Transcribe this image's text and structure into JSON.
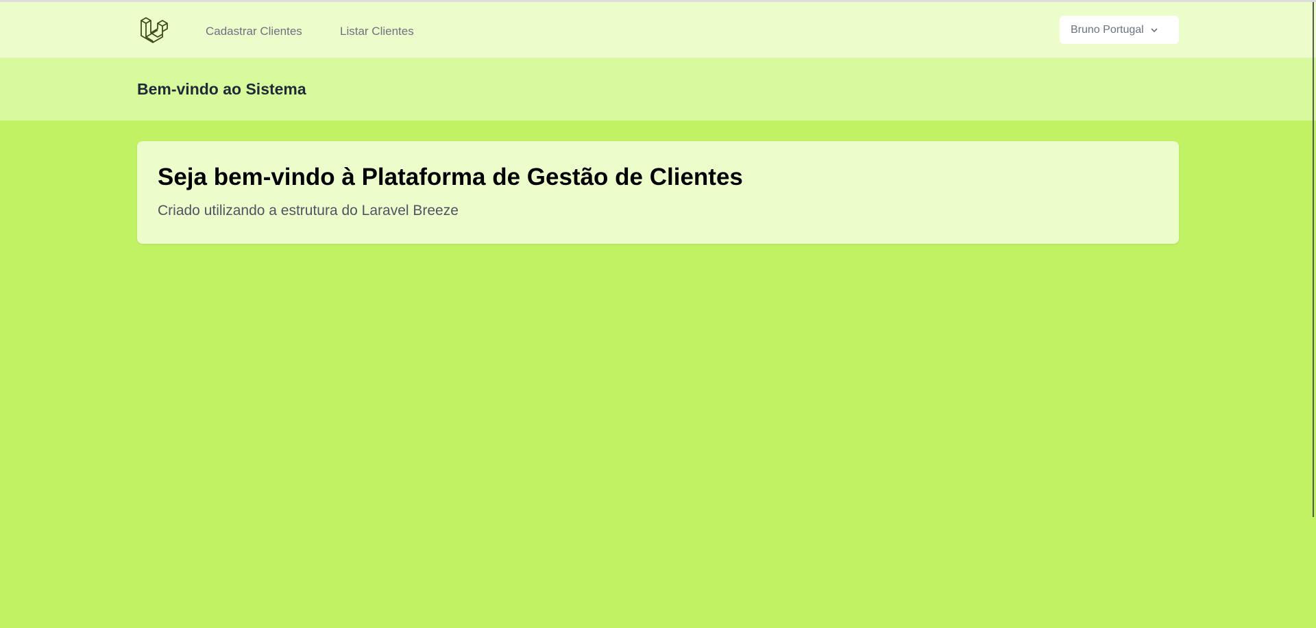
{
  "navbar": {
    "logo_icon": "laravel-logo-icon",
    "links": [
      {
        "label": "Cadastrar Clientes"
      },
      {
        "label": "Listar Clientes"
      }
    ],
    "user_menu": {
      "label": "Bruno Portugal",
      "icon": "chevron-down-icon"
    }
  },
  "header": {
    "title": "Bem-vindo ao Sistema"
  },
  "main": {
    "card": {
      "heading": "Seja bem-vindo à Plataforma de Gestão de Clientes",
      "subtitle": "Criado utilizando a estrutura do Laravel Breeze"
    }
  },
  "colors": {
    "page_background": "#c1f264",
    "navbar_background": "#ecfccb",
    "header_background": "#d9f99d",
    "card_background": "#ecfccb"
  }
}
